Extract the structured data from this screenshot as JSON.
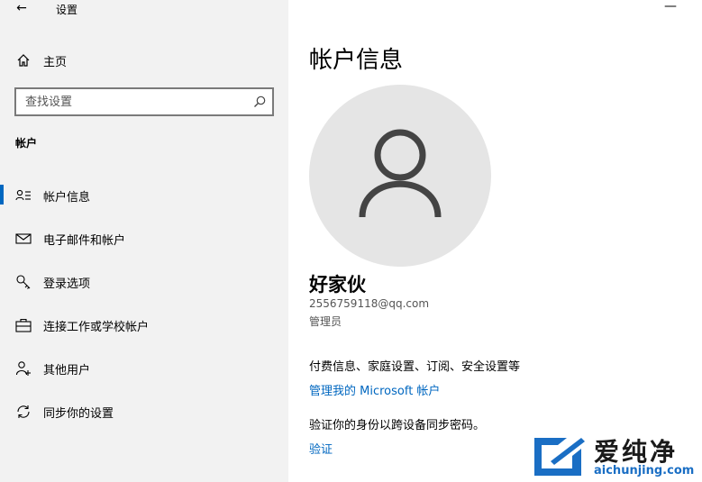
{
  "window": {
    "app_title": "设置",
    "back_glyph": "←",
    "minimize_glyph": "—"
  },
  "sidebar": {
    "home_label": "主页",
    "search": {
      "placeholder": "查找设置",
      "value": ""
    },
    "section_title": "帐户",
    "items": [
      {
        "label": "帐户信息",
        "icon": "account-info-icon",
        "active": true
      },
      {
        "label": "电子邮件和帐户",
        "icon": "mail-icon",
        "active": false
      },
      {
        "label": "登录选项",
        "icon": "key-icon",
        "active": false
      },
      {
        "label": "连接工作或学校帐户",
        "icon": "briefcase-icon",
        "active": false
      },
      {
        "label": "其他用户",
        "icon": "add-person-icon",
        "active": false
      },
      {
        "label": "同步你的设置",
        "icon": "sync-icon",
        "active": false
      }
    ]
  },
  "main": {
    "page_title": "帐户信息",
    "user": {
      "name": "好家伙",
      "email": "2556759118@qq.com",
      "role": "管理员"
    },
    "billing_text": "付费信息、家庭设置、订阅、安全设置等",
    "manage_link": "管理我的 Microsoft 帐户",
    "verify_text": "验证你的身份以跨设备同步密码。",
    "verify_link": "验证"
  },
  "watermark": {
    "title": "爱纯净",
    "url": "aichunjing.com"
  },
  "colors": {
    "sidebar_bg": "#f2f2f2",
    "accent": "#0067c0",
    "avatar_bg": "#e5e5e5",
    "avatar_icon": "#444444"
  }
}
